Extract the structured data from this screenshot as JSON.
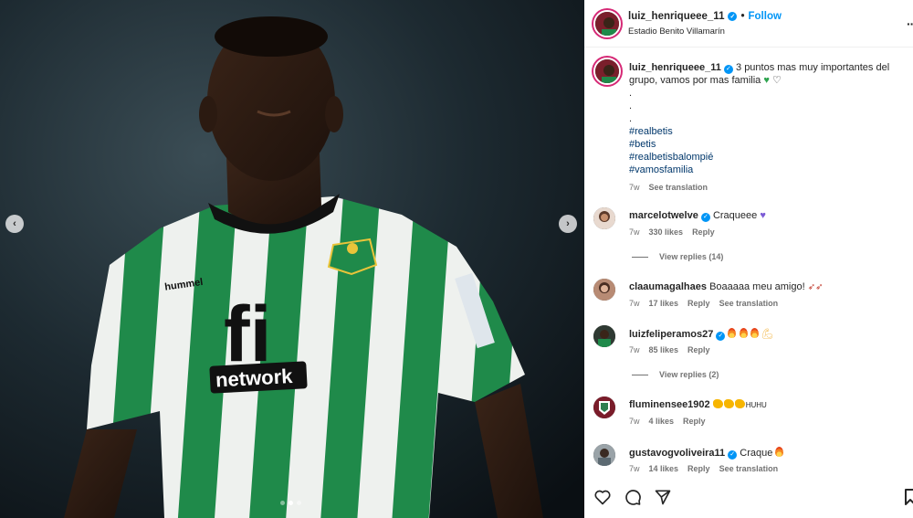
{
  "post": {
    "username": "luiz_henriqueee_11",
    "follow_label": "Follow",
    "location": "Estadio Benito Villamarín",
    "caption_text": "3 puntos mas muy importantes del grupo, vamos por mas familia",
    "caption_dots": [
      ".",
      ".",
      "."
    ],
    "hashtags": [
      "#realbetis",
      "#betis",
      "#realbetisbalompié",
      "#vamosfamilia"
    ],
    "time": "7w",
    "see_translation": "See translation",
    "jersey_sponsor_top": "fi",
    "jersey_sponsor_bottom": "network",
    "jersey_brand": "hummel",
    "carousel_index": 2,
    "carousel_total": 3
  },
  "comments": [
    {
      "username": "marcelotwelve",
      "verified": true,
      "text": "Craqueee",
      "emoji": "purple-heart",
      "time": "7w",
      "likes": "330 likes",
      "reply": "Reply",
      "translate": "",
      "replies": "View replies (14)"
    },
    {
      "username": "claaumagalhaes",
      "verified": false,
      "text": "Boaaaaa meu amigo!",
      "emoji": "rockets",
      "time": "7w",
      "likes": "17 likes",
      "reply": "Reply",
      "translate": "See translation",
      "replies": ""
    },
    {
      "username": "luizfeliperamos27",
      "verified": true,
      "text": "",
      "emoji": "fire-fire-fire-muscle",
      "time": "7w",
      "likes": "85 likes",
      "reply": "Reply",
      "translate": "",
      "replies": "View replies (2)"
    },
    {
      "username": "fluminensee1902",
      "verified": false,
      "text": "HUHU",
      "emoji": "claps",
      "time": "7w",
      "likes": "4 likes",
      "reply": "Reply",
      "translate": "",
      "replies": ""
    },
    {
      "username": "gustavogvoliveira11",
      "verified": true,
      "text": "Craque",
      "emoji": "fire",
      "time": "7w",
      "likes": "14 likes",
      "reply": "Reply",
      "translate": "See translation",
      "replies": ""
    }
  ],
  "icons": {
    "like": "heart-icon",
    "comment": "comment-icon",
    "share": "share-icon",
    "save": "bookmark-icon",
    "prev": "chevron-left-icon",
    "next": "chevron-right-icon",
    "more": "more-icon"
  },
  "colors": {
    "link": "#0095f6",
    "hashtag": "#00376b",
    "muted": "#737373",
    "jersey_green": "#1f8a4a"
  }
}
